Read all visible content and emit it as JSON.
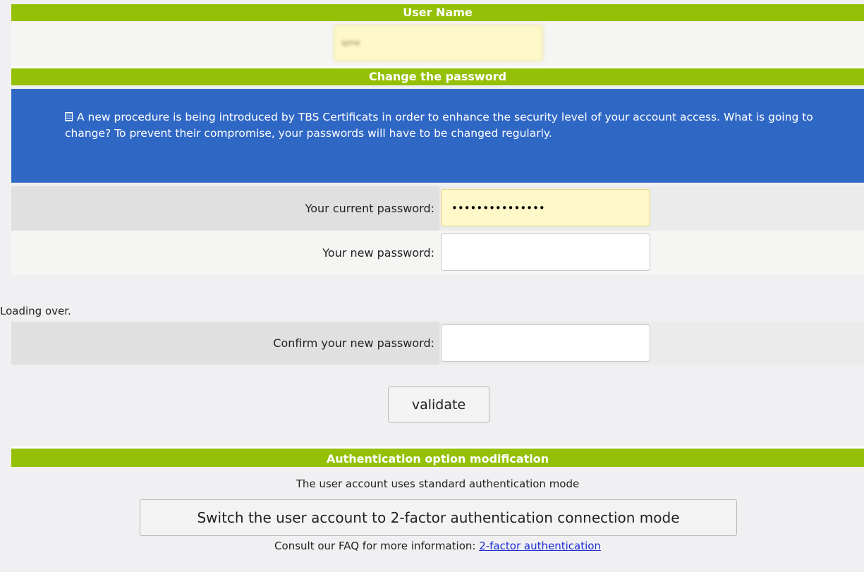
{
  "user_section": {
    "title": "User Name",
    "username_value": "qzne"
  },
  "password_section": {
    "title": "Change the password",
    "notice_icon": "document-icon",
    "notice_text": "A new procedure is being introduced by TBS Certificats in order to enhance the security level of your account access. What is going to change? To prevent their compromise, your passwords will have to be changed regularly.",
    "current_label": "Your current password:",
    "current_value": "•••••••••••••••",
    "new_label": "Your new password:",
    "new_value": "",
    "confirm_label": "Confirm your new password:",
    "confirm_value": "",
    "loading_text": "Loading over.",
    "validate_label": "validate"
  },
  "auth_section": {
    "title": "Authentication option modification",
    "status_text": "The user account uses standard authentication mode",
    "switch_label": "Switch the user account to 2-factor authentication connection mode",
    "faq_text": "Consult our FAQ for more information:",
    "faq_link": "2-factor authentication"
  },
  "colors": {
    "header_green": "#94c007",
    "notice_blue": "#2f67c5",
    "autofill_yellow": "#fff8c8",
    "link_blue": "#1c2fd8"
  }
}
